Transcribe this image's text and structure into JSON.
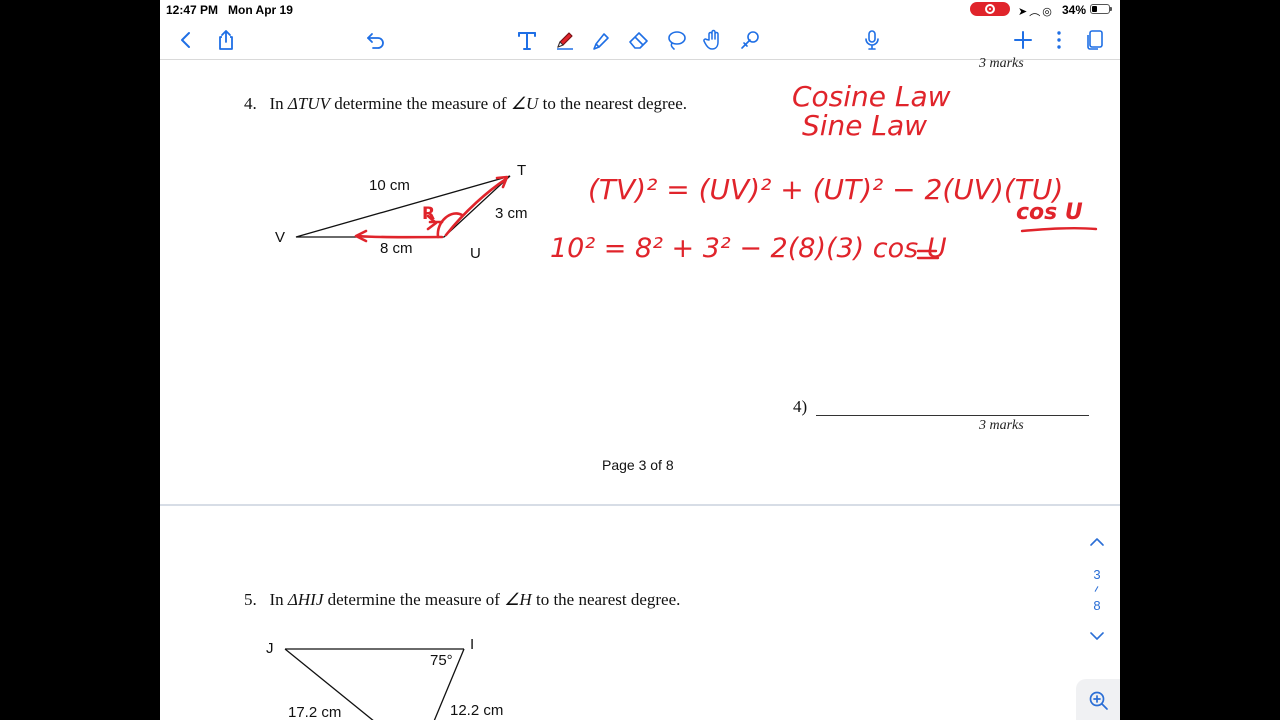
{
  "status_bar": {
    "time": "12:47 PM",
    "date": "Mon Apr 19",
    "battery": "34%",
    "battery_level": 0.34
  },
  "toolbar": {
    "icons": [
      "chevron-left-icon",
      "share-icon",
      "undo-icon",
      "text-tool-icon",
      "pen-icon",
      "highlighter-icon",
      "eraser-icon",
      "lasso-icon",
      "hand-icon",
      "shape-icon",
      "microphone-icon",
      "plus-icon",
      "more-icon",
      "pages-icon"
    ],
    "accent_color": "#1f6fe5",
    "pen_color": "#e0242b"
  },
  "document": {
    "marks_top": "3 marks",
    "question4": {
      "number": "4.",
      "prefix": "In",
      "triangle": "ΔTUV",
      "middle": "determine the measure of",
      "angle": "∠U",
      "suffix": "to the nearest degree."
    },
    "figure4": {
      "vertex_t": "T",
      "vertex_u": "U",
      "vertex_v": "V",
      "side_tv": "10 cm",
      "side_tu": "3 cm",
      "side_uv": "8 cm"
    },
    "answer4_label": "4)",
    "marks_bottom": "3 marks",
    "page_label": "Page 3 of  8",
    "question5": {
      "number": "5.",
      "prefix": "In",
      "triangle": "ΔHIJ",
      "middle": "determine the measure of",
      "angle": "∠H",
      "suffix": "to the nearest degree."
    },
    "figure5": {
      "vertex_j": "J",
      "vertex_i": "I",
      "angle_i": "75°",
      "side_jh": "17.2 cm",
      "side_ih": "12.2 cm"
    }
  },
  "annotations": {
    "line1": "Cosine Law",
    "line2": "Sine Law",
    "angle_mark": "R",
    "formula": "(TV)² = (UV)² + (UT)² − 2(UV)(TU)",
    "formula_tail": "cos U",
    "substitution": "10² = 8² + 3² − 2(8)(3) cos U"
  },
  "page_indicator": {
    "current": "3",
    "total": "8"
  }
}
